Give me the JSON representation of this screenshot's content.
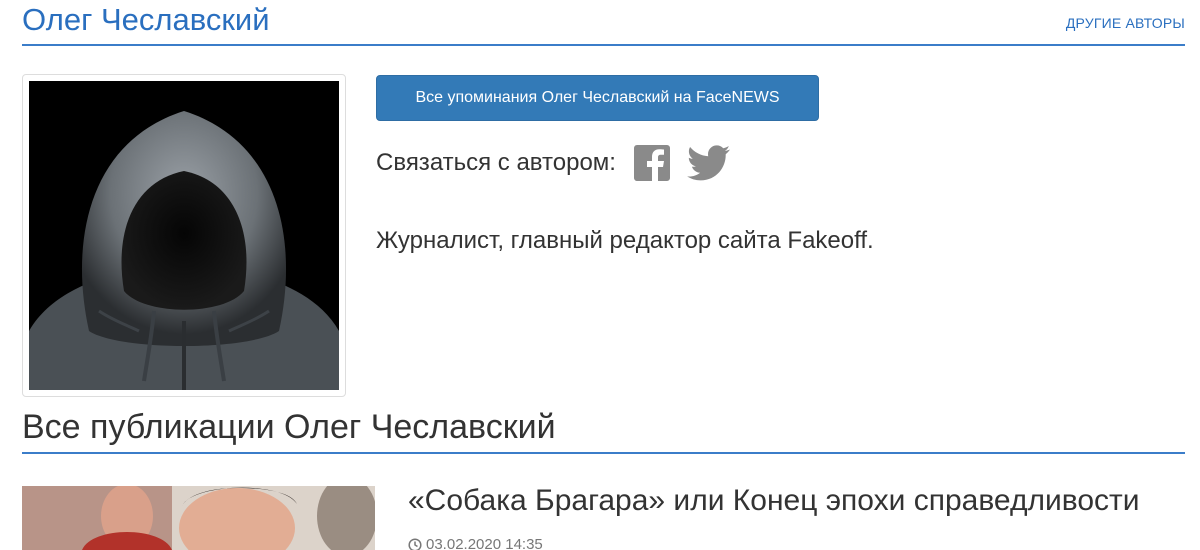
{
  "header": {
    "author_name": "Олег Чеславский",
    "other_authors_link": "ДРУГИЕ АВТОРЫ"
  },
  "profile": {
    "photo_alt": "hooded-figure-photo",
    "mentions_button": "Все упоминания Олег Чеславский на FaceNEWS",
    "contact_label": "Связаться с автором:",
    "social_icons": [
      "facebook-icon",
      "twitter-icon"
    ],
    "bio": "Журналист, главный редактор сайта Fakeoff."
  },
  "publications": {
    "section_title": "Все публикации Олег Чеславский",
    "items": [
      {
        "title": "«Собака Брагара» или Конец эпохи справедливости",
        "date": "03.02.2020 14:35"
      }
    ]
  },
  "colors": {
    "accent": "#2a6fbf",
    "button": "#337ab7",
    "rule": "#3b7dc9",
    "icon_gray": "#8a8a8a"
  }
}
